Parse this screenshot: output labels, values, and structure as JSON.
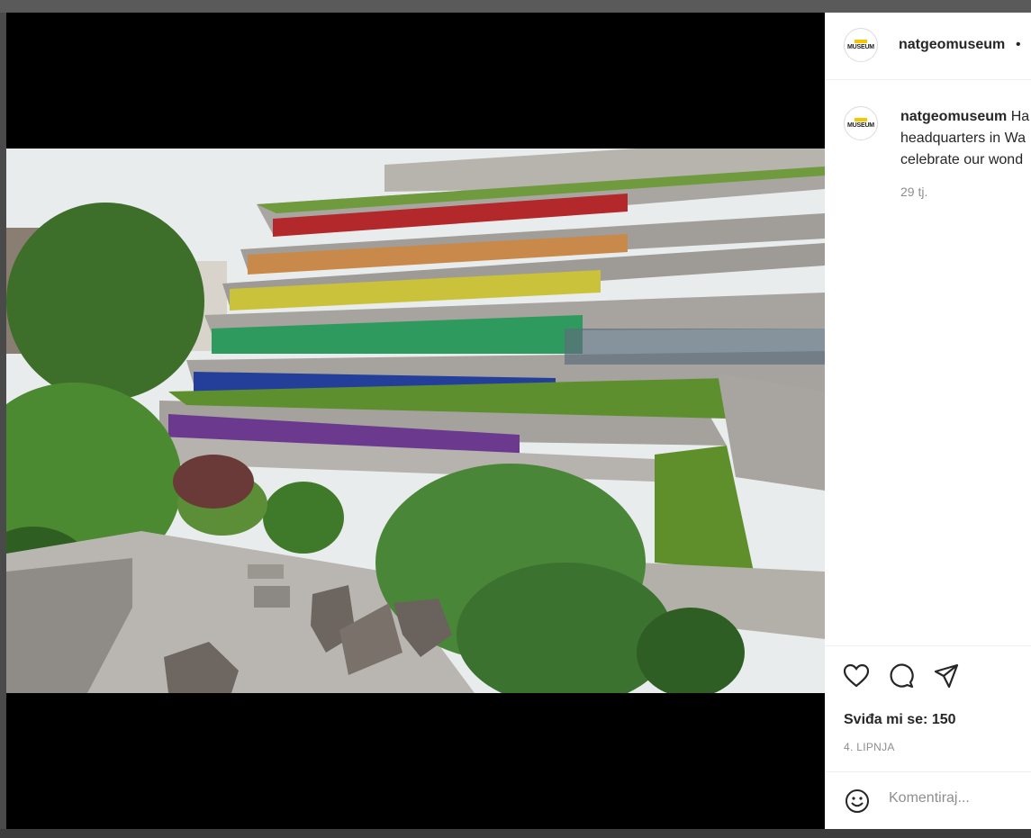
{
  "account": {
    "username": "natgeomuseum",
    "separator": "•",
    "avatar_text": "MUSEUM"
  },
  "caption": {
    "username": "natgeomuseum",
    "line1": "Ha",
    "line2": "headquarters in Wa",
    "line3": "celebrate our wond"
  },
  "post": {
    "time_ago": "29 tj.",
    "likes_label": "Sviđa mi se: 150",
    "date": "4. LIPNJA"
  },
  "comment": {
    "placeholder": "Komentiraj..."
  },
  "icons": {
    "like": "heart-icon",
    "comment": "comment-icon",
    "share": "send-icon",
    "emoji": "emoji-icon"
  },
  "colors": {
    "text": "#262626",
    "muted": "#8e8e8e",
    "border": "#efefef",
    "backdrop": "#000000"
  }
}
